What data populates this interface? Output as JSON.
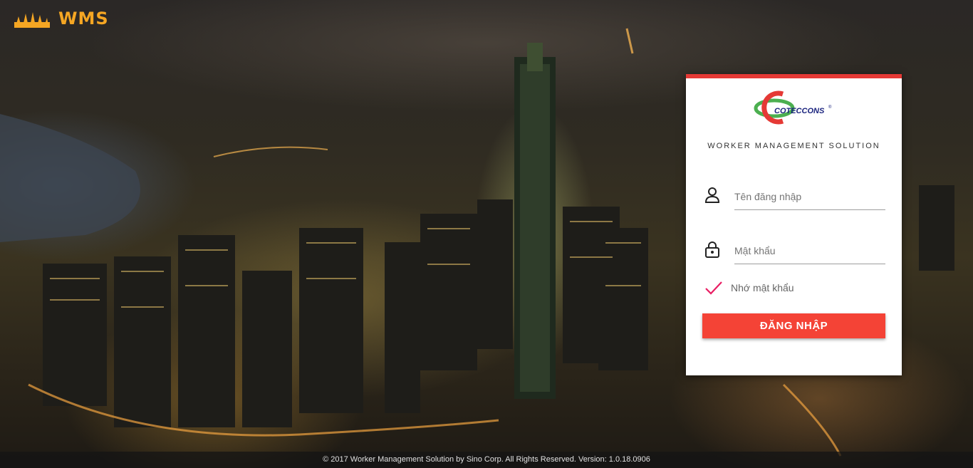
{
  "brand": {
    "name": "WMS",
    "accent": "#f5a623"
  },
  "login_card": {
    "company_logo_text": "COTECCONS",
    "subtitle": "WORKER MANAGEMENT SOLUTION",
    "username": {
      "placeholder": "Tên đăng nhập",
      "value": "",
      "icon": "user-icon"
    },
    "password": {
      "placeholder": "Mật khẩu",
      "value": "",
      "icon": "lock-icon"
    },
    "remember": {
      "label": "Nhớ mật khẩu",
      "checked": true
    },
    "login_button": "ĐĂNG NHẬP",
    "accent": "#e53935",
    "button_color": "#f44336"
  },
  "footer": {
    "text": "© 2017 Worker Management Solution by Sino Corp. All Rights Reserved. Version: 1.0.18.0906"
  }
}
